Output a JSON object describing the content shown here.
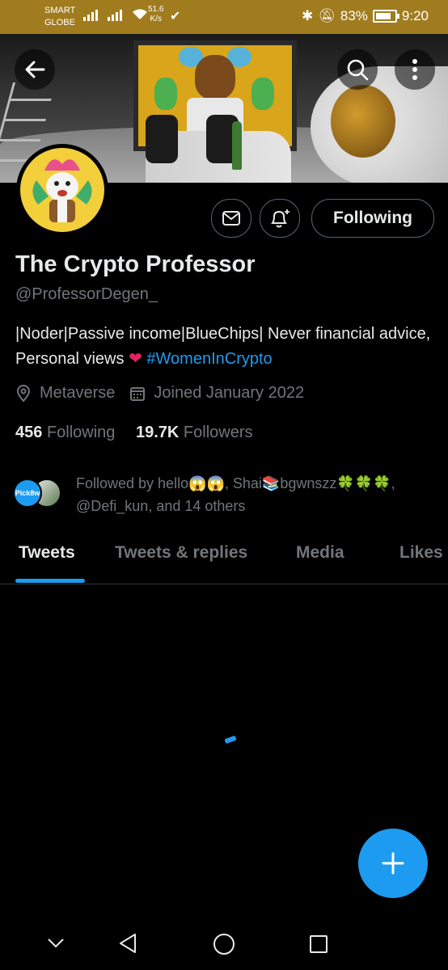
{
  "status_bar": {
    "carrier_line1": "SMART",
    "carrier_line2": "GLOBE",
    "speed_value": "51.6",
    "speed_unit": "K/s",
    "battery": "83%",
    "time": "9:20"
  },
  "header": {
    "back_icon": "arrow-left-icon",
    "search_icon": "search-icon",
    "more_icon": "more-vertical-icon"
  },
  "profile": {
    "name": "The Crypto Professor",
    "handle": "@ProfessorDegen_",
    "bio_text": "|Noder|Passive income|BlueChips| Never financial advice, Personal views",
    "bio_hashtag": "#WomenInCrypto",
    "location": "Metaverse",
    "joined": "Joined January 2022",
    "following_count": "456",
    "following_label": "Following",
    "followers_count": "19.7K",
    "followers_label": "Followers",
    "followed_by": "Followed by hello😱😱, Shai📚bgwnszz🍀🍀🍀, @Defi_kun, and 14 others",
    "mini_avatar_text": "Pick8w"
  },
  "actions": {
    "message_icon": "mail-icon",
    "notify_icon": "bell-plus-icon",
    "follow_label": "Following"
  },
  "tabs": [
    {
      "label": "Tweets",
      "active": true
    },
    {
      "label": "Tweets & replies",
      "active": false
    },
    {
      "label": "Media",
      "active": false
    },
    {
      "label": "Likes",
      "active": false
    }
  ],
  "fab_icon": "plus-icon",
  "colors": {
    "accent": "#1d9bf0",
    "status_bar": "#a07c1f",
    "background": "#000000",
    "heart": "#e0245e"
  }
}
